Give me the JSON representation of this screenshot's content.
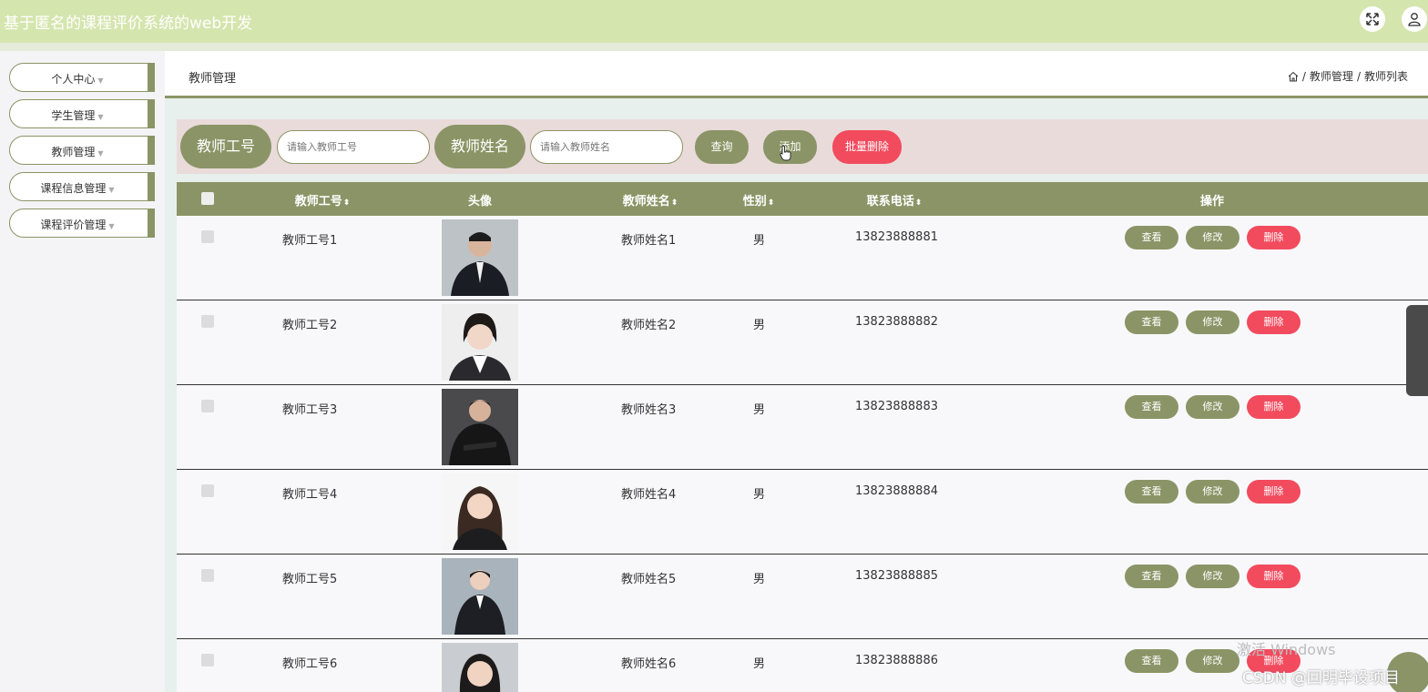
{
  "app": {
    "title": "基于匿名的课程评价系统的web开发"
  },
  "sidebar": {
    "items": [
      {
        "label": "个人中心"
      },
      {
        "label": "学生管理"
      },
      {
        "label": "教师管理"
      },
      {
        "label": "课程信息管理"
      },
      {
        "label": "课程评价管理"
      }
    ]
  },
  "header": {
    "title": "教师管理"
  },
  "breadcrumb": {
    "level1": "教师管理",
    "level2": "教师列表",
    "sep": "/"
  },
  "search": {
    "label_id": "教师工号",
    "placeholder_id": "请输入教师工号",
    "label_name": "教师姓名",
    "placeholder_name": "请输入教师姓名",
    "query": "查询",
    "add": "添加",
    "batch_delete": "批量删除"
  },
  "table": {
    "headers": {
      "id": "教师工号",
      "avatar": "头像",
      "name": "教师姓名",
      "gender": "性别",
      "phone": "联系电话",
      "ops": "操作"
    },
    "actions": {
      "view": "查看",
      "edit": "修改",
      "delete": "删除"
    },
    "rows": [
      {
        "id": "教师工号1",
        "name": "教师姓名1",
        "gender": "男",
        "phone": "13823888881"
      },
      {
        "id": "教师工号2",
        "name": "教师姓名2",
        "gender": "男",
        "phone": "13823888882"
      },
      {
        "id": "教师工号3",
        "name": "教师姓名3",
        "gender": "男",
        "phone": "13823888883"
      },
      {
        "id": "教师工号4",
        "name": "教师姓名4",
        "gender": "男",
        "phone": "13823888884"
      },
      {
        "id": "教师工号5",
        "name": "教师姓名5",
        "gender": "男",
        "phone": "13823888885"
      },
      {
        "id": "教师工号6",
        "name": "教师姓名6",
        "gender": "男",
        "phone": "13823888886"
      }
    ]
  },
  "overlay": {
    "watermark": "激活 Windows",
    "csdn": "CSDN @回明毕设项目"
  },
  "colors": {
    "accent": "#8b9466",
    "topbar": "#d5e5ae",
    "danger": "#f24b5e"
  }
}
